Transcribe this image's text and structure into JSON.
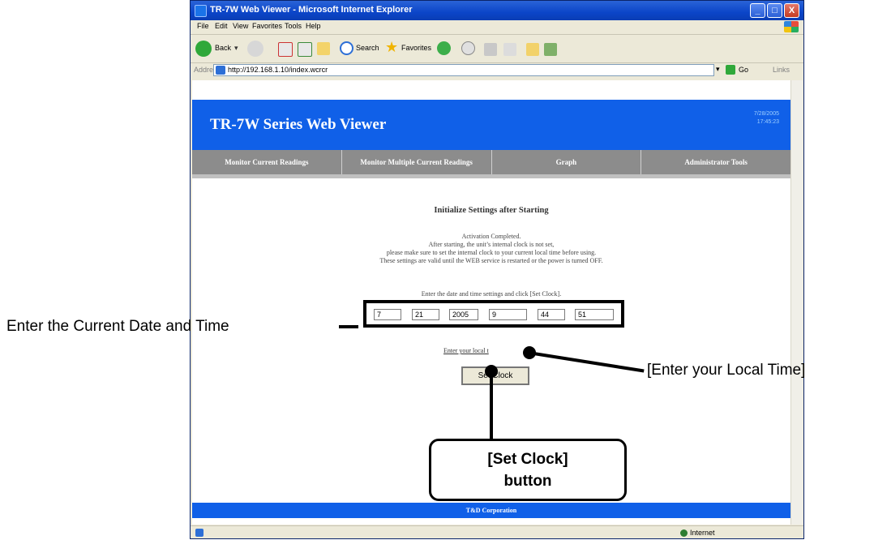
{
  "window": {
    "title": "TR-7W Web Viewer - Microsoft Internet Explorer",
    "buttons": [
      "_",
      "□",
      "X"
    ]
  },
  "menu": [
    "File",
    "Edit",
    "View",
    "Favorites",
    "Tools",
    "Help"
  ],
  "toolbar": {
    "back_label": "Back",
    "search_label": "Search",
    "favorites_label": "Favorites"
  },
  "address": {
    "label": "Address",
    "url": "http://192.168.1.10/index.wcrcr",
    "go_label": "Go",
    "links_label": "Links"
  },
  "page": {
    "header_title": "TR-7W Series Web Viewer",
    "header_date": "7/28/2005",
    "header_time": "17:45:23",
    "nav": [
      "Monitor Current Readings",
      "Monitor Multiple Current Readings",
      "Graph",
      "Administrator Tools"
    ],
    "heading": "Initialize Settings after Starting",
    "msg1": "Activation Completed.",
    "msg2": "After starting, the unit’s internal clock is not set,",
    "msg3": "please make sure to set the internal clock to your current local time before using.",
    "msg4": "These settings are valid until the WEB service is restarted or the power is turned OFF.",
    "enter_text": "Enter the date and time settings and click [Set Clock].",
    "fields": {
      "month": "7",
      "day": "21",
      "year": "2005",
      "hour": "9",
      "minute": "44",
      "second": "51"
    },
    "local_link": "Enter your local t",
    "set_clock_label": "Set Clock",
    "footer": "T&D Corporation"
  },
  "status": {
    "zone": "Internet"
  },
  "annotations": {
    "date_time": "Enter the Current Date and Time",
    "local_time": "[Enter your Local Time]",
    "callout_line1": "[Set Clock]",
    "callout_line2": "button"
  }
}
